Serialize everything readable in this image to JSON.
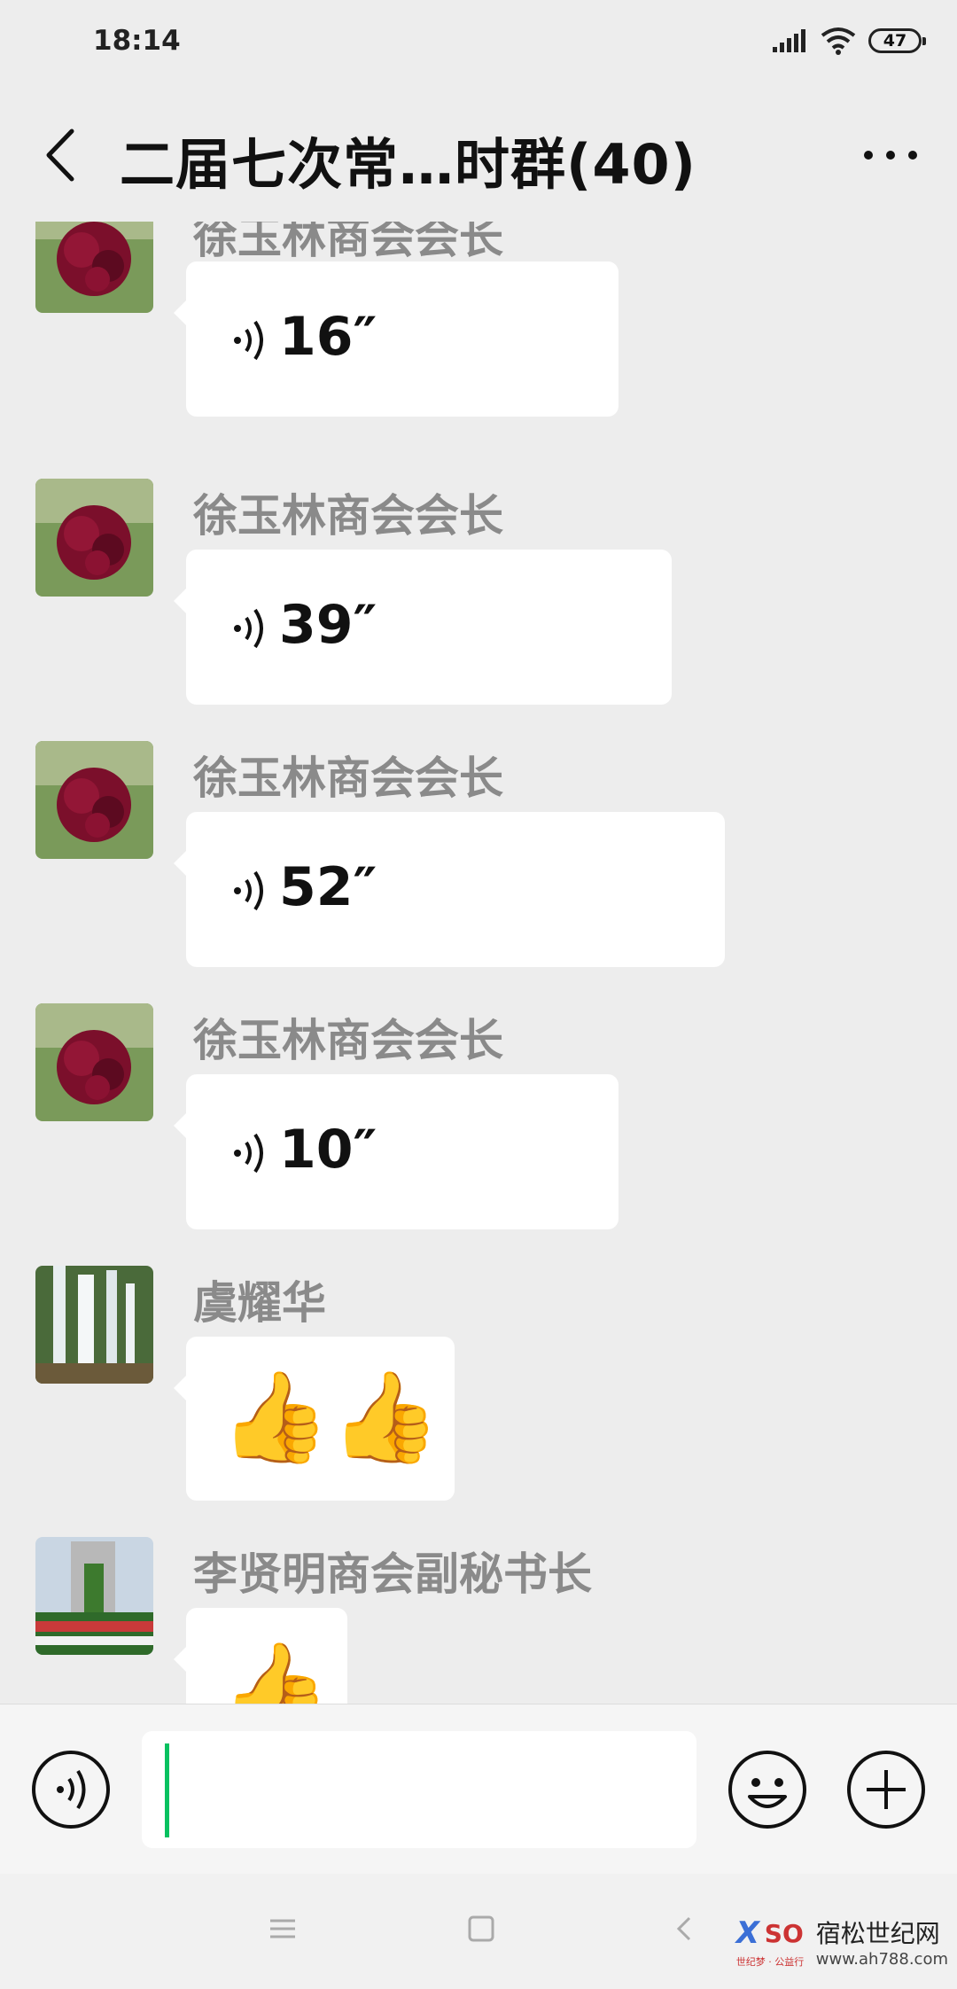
{
  "status_bar": {
    "time": "18:14",
    "battery": "47"
  },
  "header": {
    "title": "二届七次常…时群(40)"
  },
  "messages": [
    {
      "sender": "徐玉林商会会长",
      "duration": "16″",
      "kind": "voice",
      "avatar": "peony"
    },
    {
      "sender": "徐玉林商会会长",
      "duration": "39″",
      "kind": "voice",
      "avatar": "peony"
    },
    {
      "sender": "徐玉林商会会长",
      "duration": "52″",
      "kind": "voice",
      "avatar": "peony"
    },
    {
      "sender": "徐玉林商会会长",
      "duration": "10″",
      "kind": "voice",
      "avatar": "peony"
    },
    {
      "sender": "虞耀华",
      "kind": "emoji",
      "emoji": "👍👍",
      "avatar": "waterfall"
    },
    {
      "sender": "李贤明商会副秘书长",
      "kind": "emoji",
      "emoji": "👍",
      "avatar": "garden"
    }
  ],
  "input": {
    "value": ""
  },
  "watermark": {
    "name": "宿松世纪网",
    "url": "www.ah788.com",
    "logo_text": "SO",
    "logo_sub": "世纪梦 · 公益行"
  },
  "colors": {
    "caret": "#07c160",
    "background": "#ededed",
    "bubble": "#ffffff"
  }
}
